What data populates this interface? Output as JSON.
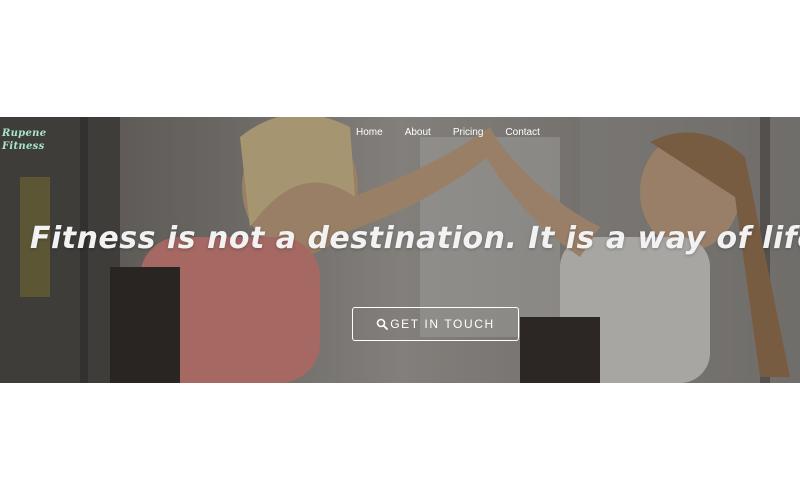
{
  "brand": {
    "line1": "Rupene",
    "line2": "Fitness"
  },
  "nav": {
    "items": [
      {
        "label": "Home"
      },
      {
        "label": "About"
      },
      {
        "label": "Pricing"
      },
      {
        "label": "Contact"
      }
    ]
  },
  "hero": {
    "headline": "Fitness is not a destination. It is a way of life.",
    "cta_label": "GET IN TOUCH",
    "cta_icon": "search-icon"
  },
  "colors": {
    "brand_text": "#a8e6c8",
    "nav_text": "#ffffff",
    "cta_border": "#ffffff"
  }
}
